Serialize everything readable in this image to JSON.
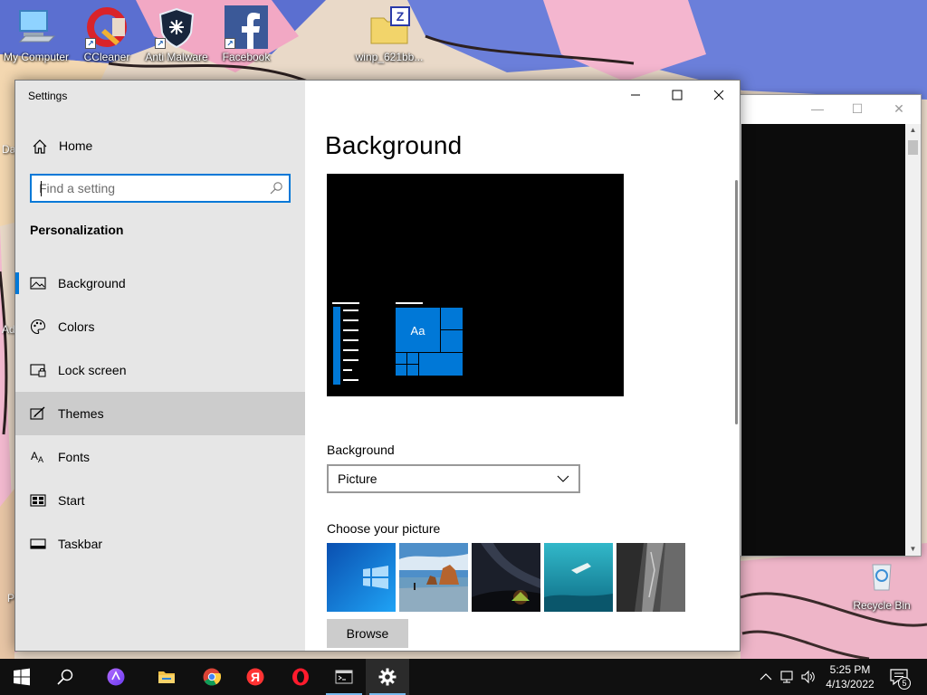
{
  "desktop": {
    "icons": [
      {
        "label": "My Computer",
        "icon": "computer-icon"
      },
      {
        "label": "CCleaner",
        "icon": "ccleaner-icon"
      },
      {
        "label": "Anti Malware",
        "icon": "shield-icon"
      },
      {
        "label": "Facebook",
        "icon": "facebook-icon"
      },
      {
        "label": "winp_621bb...",
        "icon": "zip-folder-icon"
      },
      {
        "label": "Recycle Bin",
        "icon": "recycle-bin-icon"
      }
    ],
    "edge_fragments": [
      "Da",
      "Ad",
      "P"
    ]
  },
  "settings": {
    "window_title": "Settings",
    "home_label": "Home",
    "search": {
      "placeholder": "Find a setting",
      "value": ""
    },
    "section_title": "Personalization",
    "nav_items": [
      {
        "label": "Background",
        "icon": "picture-icon",
        "selected": true
      },
      {
        "label": "Colors",
        "icon": "palette-icon"
      },
      {
        "label": "Lock screen",
        "icon": "lock-screen-icon"
      },
      {
        "label": "Themes",
        "icon": "brush-icon",
        "hovered": true
      },
      {
        "label": "Fonts",
        "icon": "fonts-icon"
      },
      {
        "label": "Start",
        "icon": "start-tiles-icon"
      },
      {
        "label": "Taskbar",
        "icon": "taskbar-icon"
      }
    ],
    "main": {
      "page_title": "Background",
      "preview_tile_text": "Aa",
      "background_label": "Background",
      "background_value": "Picture",
      "choose_picture_label": "Choose your picture",
      "pictures": [
        "windows-blue",
        "beach-rocks",
        "night-sky-tent",
        "underwater-swimmer",
        "rock-cliff"
      ],
      "browse_label": "Browse"
    },
    "accent_color": "#0078d7"
  },
  "taskbar": {
    "items": [
      {
        "name": "start",
        "icon": "windows-logo-icon"
      },
      {
        "name": "search",
        "icon": "search-icon"
      },
      {
        "name": "alice",
        "icon": "alice-assistant-icon"
      },
      {
        "name": "file-explorer",
        "icon": "folder-icon"
      },
      {
        "name": "chrome",
        "icon": "chrome-icon"
      },
      {
        "name": "yandex",
        "icon": "yandex-browser-icon"
      },
      {
        "name": "opera",
        "icon": "opera-icon"
      },
      {
        "name": "command-prompt",
        "icon": "cmd-icon"
      },
      {
        "name": "settings",
        "icon": "gear-icon",
        "active": true
      }
    ],
    "yandex_glyph": "Я",
    "time": "5:25 PM",
    "date": "4/13/2022",
    "notification_count": "5"
  }
}
